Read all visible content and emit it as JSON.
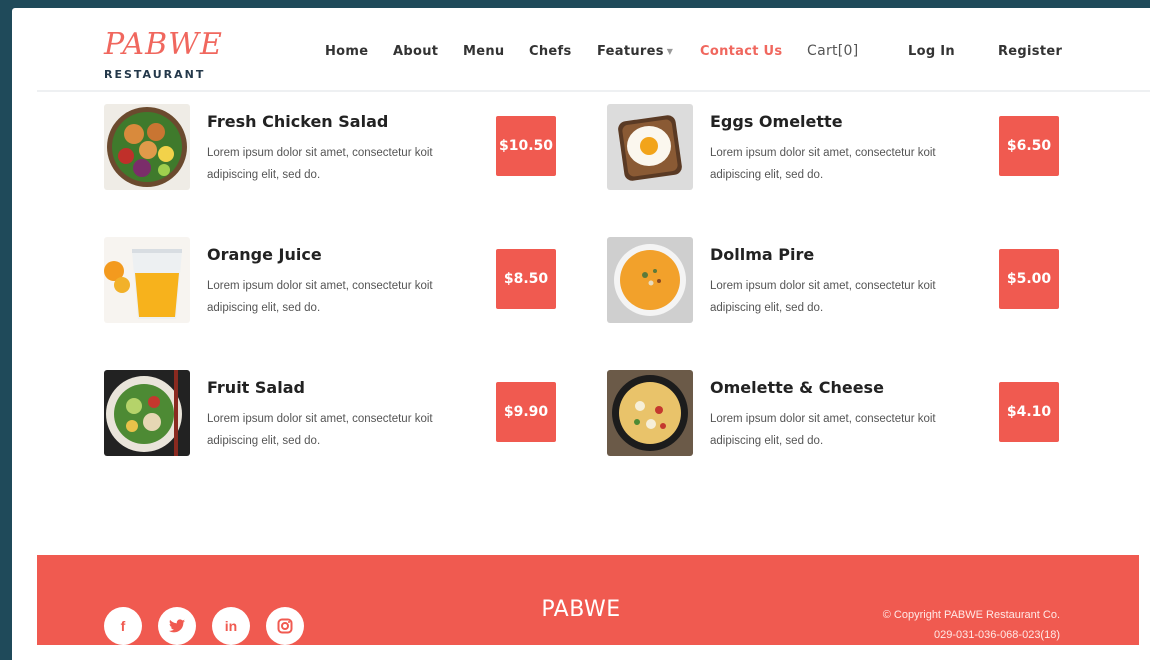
{
  "brand": {
    "name": "PABWE",
    "subtitle": "RESTAURANT",
    "accent": "#f05a50",
    "logo_color": "#f0675e"
  },
  "nav": {
    "home": "Home",
    "about": "About",
    "menu": "Menu",
    "chefs": "Chefs",
    "features": "Features",
    "contact": "Contact Us",
    "cart": "Cart[0]",
    "login": "Log In",
    "register": "Register"
  },
  "menu": {
    "items": [
      {
        "name": "Fresh Chicken Salad",
        "desc": "Lorem ipsum dolor sit amet, consectetur koit adipiscing elit, sed do.",
        "price": "$10.50",
        "image": "chicken-salad-image"
      },
      {
        "name": "Eggs Omelette",
        "desc": "Lorem ipsum dolor sit amet, consectetur koit adipiscing elit, sed do.",
        "price": "$6.50",
        "image": "egg-toast-image"
      },
      {
        "name": "Orange Juice",
        "desc": "Lorem ipsum dolor sit amet, consectetur koit adipiscing elit, sed do.",
        "price": "$8.50",
        "image": "orange-juice-image"
      },
      {
        "name": "Dollma Pire",
        "desc": "Lorem ipsum dolor sit amet, consectetur koit adipiscing elit, sed do.",
        "price": "$5.00",
        "image": "soup-bowl-image"
      },
      {
        "name": "Fruit Salad",
        "desc": "Lorem ipsum dolor sit amet, consectetur koit adipiscing elit, sed do.",
        "price": "$9.90",
        "image": "fruit-salad-image"
      },
      {
        "name": "Omelette & Cheese",
        "desc": "Lorem ipsum dolor sit amet, consectetur koit adipiscing elit, sed do.",
        "price": "$4.10",
        "image": "omelette-pan-image"
      }
    ]
  },
  "footer": {
    "brand": "PABWE",
    "copyright": "© Copyright PABWE Restaurant Co.",
    "phone": "029-031-036-068-023(18)",
    "socials": [
      {
        "label": "f",
        "icon": "facebook-icon"
      },
      {
        "label": "t",
        "icon": "twitter-icon"
      },
      {
        "label": "in",
        "icon": "linkedin-icon"
      },
      {
        "label": "ig",
        "icon": "instagram-icon"
      }
    ]
  }
}
